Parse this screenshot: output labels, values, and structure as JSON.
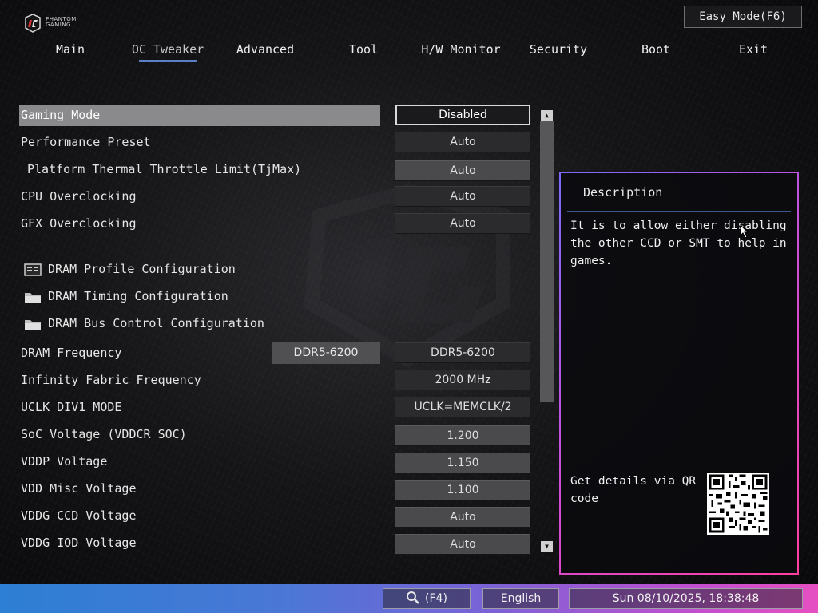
{
  "logo": {
    "line1": "PHANTOM",
    "line2": "GAMING"
  },
  "header": {
    "easy_mode": "Easy Mode(F6)"
  },
  "tabs": [
    {
      "label": "Main"
    },
    {
      "label": "OC Tweaker",
      "active": true
    },
    {
      "label": "Advanced"
    },
    {
      "label": "Tool"
    },
    {
      "label": "H/W Monitor"
    },
    {
      "label": "Security"
    },
    {
      "label": "Boot"
    },
    {
      "label": "Exit"
    }
  ],
  "settings": {
    "gaming_mode": {
      "label": "Gaming Mode",
      "value": "Disabled"
    },
    "performance_preset": {
      "label": "Performance Preset",
      "value": "Auto"
    },
    "platform_thermal": {
      "label": "Platform Thermal Throttle Limit(TjMax)",
      "value": "Auto"
    },
    "cpu_oc": {
      "label": "CPU Overclocking",
      "value": "Auto"
    },
    "gfx_oc": {
      "label": "GFX Overclocking",
      "value": "Auto"
    },
    "dram_profile": {
      "label": "DRAM Profile Configuration"
    },
    "dram_timing": {
      "label": "DRAM Timing Configuration"
    },
    "dram_bus": {
      "label": "DRAM Bus Control Configuration"
    },
    "dram_freq": {
      "label": "DRAM Frequency",
      "current": "DDR5-6200",
      "value": "DDR5-6200"
    },
    "infinity_fabric": {
      "label": "Infinity Fabric Frequency",
      "value": "2000 MHz"
    },
    "uclk": {
      "label": "UCLK DIV1 MODE",
      "value": "UCLK=MEMCLK/2"
    },
    "soc_voltage": {
      "label": "SoC Voltage (VDDCR_SOC)",
      "value": "1.200"
    },
    "vddp": {
      "label": "VDDP Voltage",
      "value": "1.150"
    },
    "vdd_misc": {
      "label": "VDD Misc Voltage",
      "value": "1.100"
    },
    "vddg_ccd": {
      "label": "VDDG CCD Voltage",
      "value": "Auto"
    },
    "vddg_iod": {
      "label": "VDDG IOD Voltage",
      "value": "Auto"
    }
  },
  "description": {
    "title": "Description",
    "text": "It is to allow either disabling\nthe other CCD or SMT to help in\ngames.",
    "qr_label": "Get details via QR\ncode"
  },
  "statusbar": {
    "search": "(F4)",
    "language": "English",
    "datetime": "Sun 08/10/2025, 18:38:48"
  },
  "colors": {
    "tab_underline": "#5b7fc4",
    "panel_border_start": "#7a6cff",
    "panel_border_end": "#ff3fa0",
    "statusbar_start": "#2c7fd4",
    "statusbar_end": "#e64fc0"
  }
}
